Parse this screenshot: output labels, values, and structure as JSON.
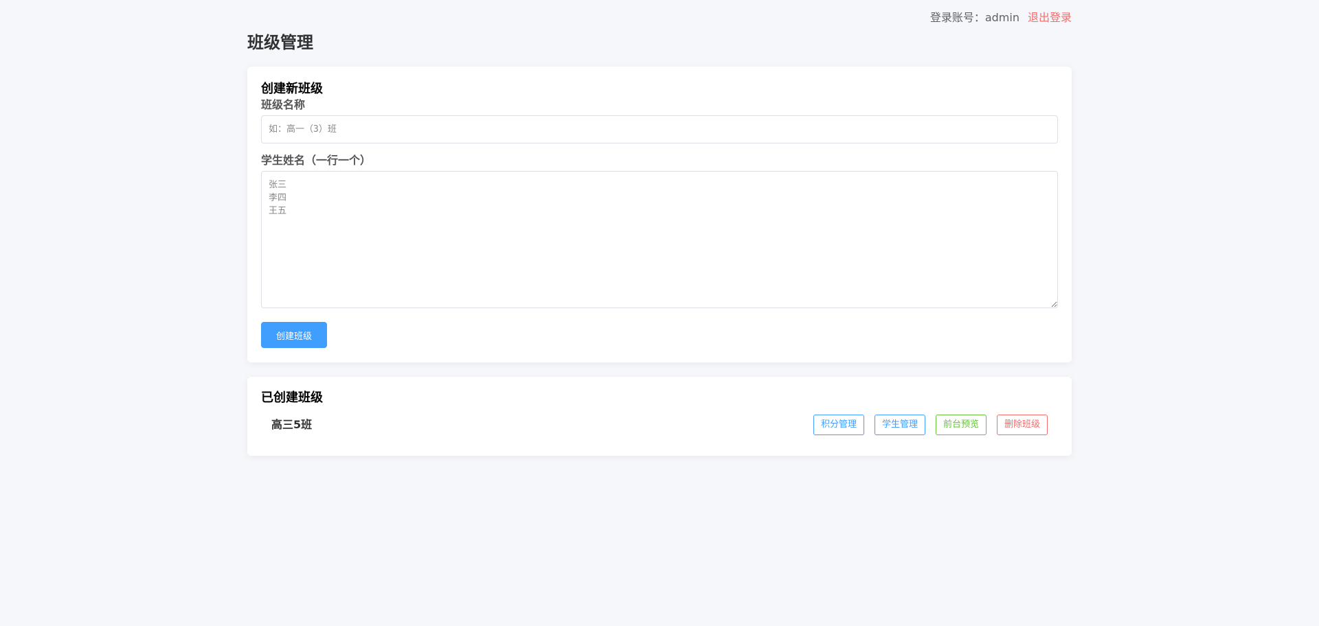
{
  "header": {
    "account_label": "登录账号：admin",
    "logout_label": "退出登录"
  },
  "page": {
    "title": "班级管理"
  },
  "create_form": {
    "title": "创建新班级",
    "class_name_label": "班级名称",
    "class_name_placeholder": "如：高一（3）班",
    "class_name_value": "",
    "students_label": "学生姓名（一行一个）",
    "students_placeholder": "张三\n李四\n王五",
    "students_value": "",
    "submit_label": "创建班级"
  },
  "class_list": {
    "title": "已创建班级",
    "items": [
      {
        "name": "高三5班",
        "actions": {
          "points": "积分管理",
          "students": "学生管理",
          "preview": "前台预览",
          "delete": "删除班级"
        }
      }
    ]
  },
  "colors": {
    "background": "#f5f7fa",
    "primary": "#409eff",
    "success": "#67c23a",
    "danger": "#f56c6c"
  }
}
